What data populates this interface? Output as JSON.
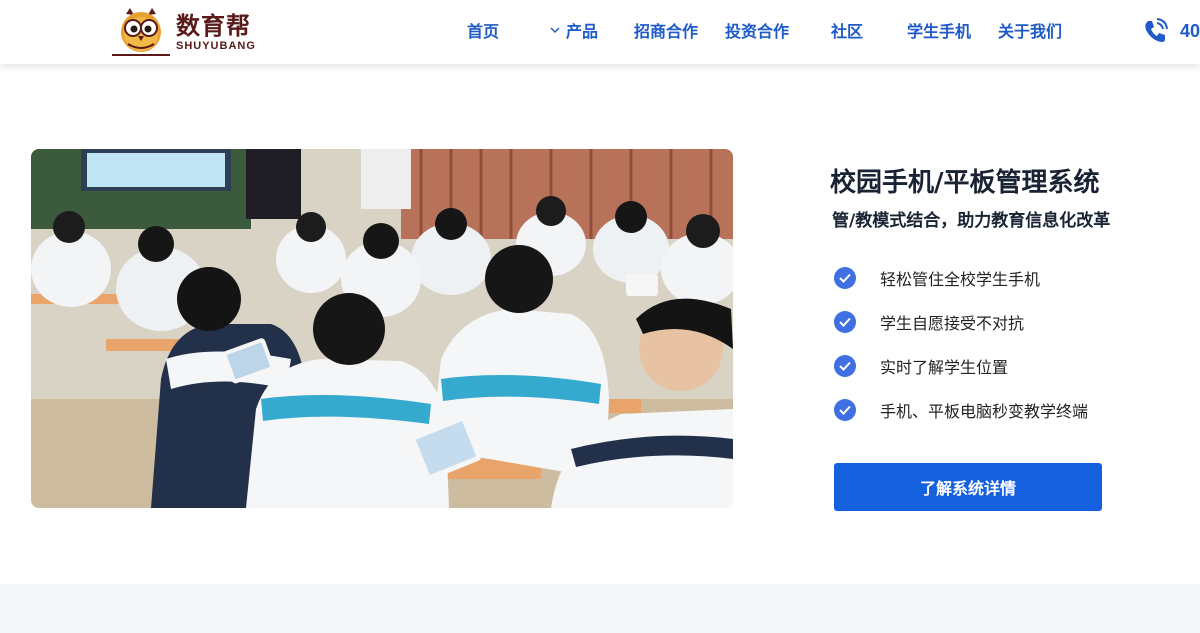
{
  "brand": {
    "name_cn": "数育帮",
    "name_en": "SHUYUBANG"
  },
  "nav": {
    "items": [
      {
        "label": "首页"
      },
      {
        "label": "产品"
      },
      {
        "label": "招商合作"
      },
      {
        "label": "投资合作"
      },
      {
        "label": "社区"
      },
      {
        "label": "学生手机"
      },
      {
        "label": "关于我们"
      }
    ],
    "phone": "40"
  },
  "hero": {
    "title": "校园手机/平板管理系统",
    "subtitle": "管/教模式结合，助力教育信息化改革",
    "features": [
      "轻松管住全校学生手机",
      "学生自愿接受不对抗",
      "实时了解学生位置",
      "手机、平板电脑秒变教学终端"
    ],
    "cta_label": "了解系统详情"
  },
  "colors": {
    "accent": "#1560de",
    "nav_text": "#1e5ac8",
    "brand": "#5a1a1a"
  }
}
